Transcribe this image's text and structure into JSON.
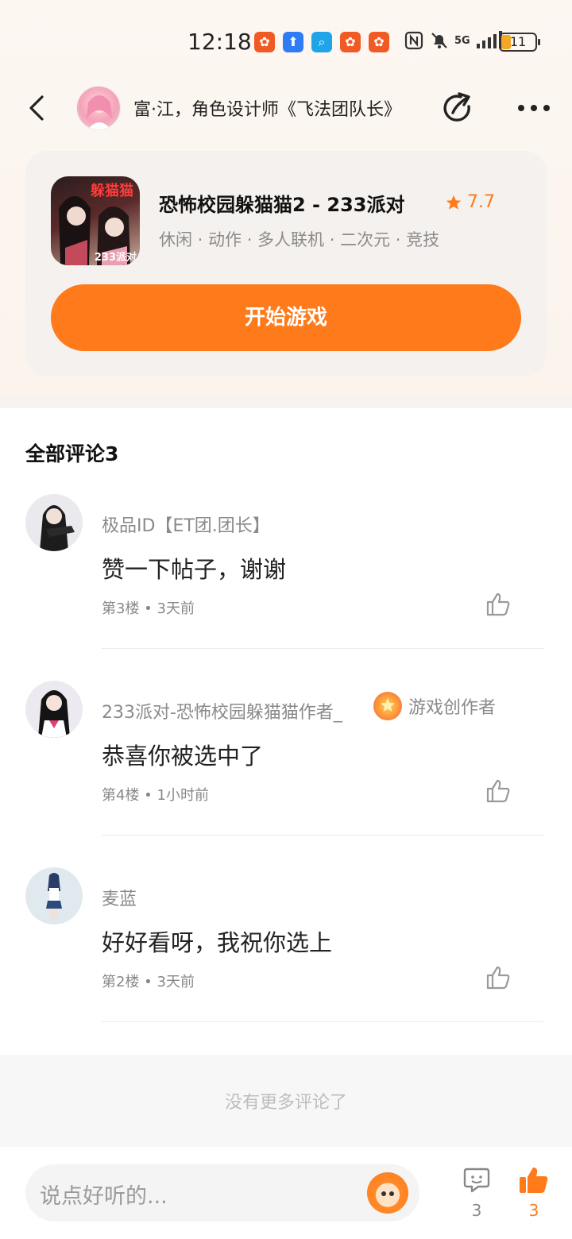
{
  "status_bar": {
    "time": "12:18",
    "network": "5G",
    "battery": "11"
  },
  "header": {
    "title": "富·江，角色设计师《飞法团队长》",
    "back_icon": "chevron-left-icon",
    "share_icon": "share-icon",
    "more_icon": "more-dots-icon"
  },
  "game": {
    "name": "恐怖校园躲猫猫2 - 233派对",
    "rating": "7.7",
    "tags": "休闲 · 动作 · 多人联机 · 二次元 · 竞技",
    "icon_tag": "躲猫猫",
    "icon_num": "233派对",
    "start_label": "开始游戏"
  },
  "comments_section": {
    "title": "全部评论3",
    "items": [
      {
        "name": "极品ID【ET团.团长】",
        "text": "赞一下帖子，谢谢",
        "meta": "第3楼 • 3天前",
        "badge": ""
      },
      {
        "name": "233派对-恐怖校园躲猫猫作者_",
        "text": "恭喜你被选中了",
        "meta": "第4楼 • 1小时前",
        "badge": "游戏创作者"
      },
      {
        "name": "麦蓝",
        "text": "好好看呀，我祝你选上",
        "meta": "第2楼 • 3天前",
        "badge": ""
      }
    ],
    "no_more": "没有更多评论了"
  },
  "bottom_bar": {
    "input_placeholder": "说点好听的...",
    "comment_count": "3",
    "like_count": "3"
  },
  "colors": {
    "accent": "#ff7a1a",
    "rating": "#ff7a1a"
  }
}
